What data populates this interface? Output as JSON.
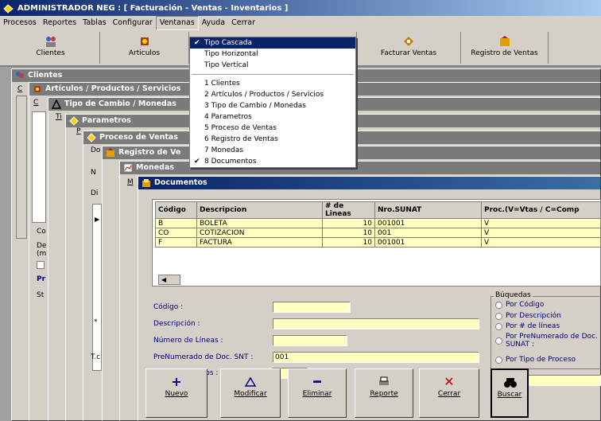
{
  "app": {
    "title": "ADMINISTRADOR NEG : [ Facturación - Ventas - Inventarios ]"
  },
  "menubar": [
    "Procesos",
    "Reportes",
    "Tablas",
    "Configurar",
    "Ventanas",
    "Ayuda",
    "Cerrar"
  ],
  "toolbar": {
    "clientes": "Clientes",
    "articulos": "Articulos",
    "facturar": "Facturar Ventas",
    "registro": "Registro de Ventas"
  },
  "ventanas_menu": {
    "layout_items": [
      "Tipo Cascada",
      "Tipo Horizontal",
      "Tipo Vertical"
    ],
    "window_items": [
      "1 Clientes",
      "2 Artículos / Productos / Servicios",
      "3 Tipo de Cambio / Monedas",
      "4 Parametros",
      "5 Proceso de Ventas",
      "6 Registro de Ventas",
      "7 Monedas",
      "8 Documentos"
    ]
  },
  "windows": {
    "clientes": "Clientes",
    "articulos": "Artículos / Productos / Servicios",
    "tipo_cambio": "Tipo de Cambio / Monedas",
    "parametros": "Parametros",
    "proceso": "Proceso de Ventas",
    "registro": "Registro de Ve",
    "monedas": "Monedas",
    "documentos": "Documentos"
  },
  "bg_labels": {
    "c1": "C",
    "c2": "C",
    "ti": "Ti",
    "p": "P",
    "do": "Do",
    "n": "N",
    "di": "Di",
    "m": "M",
    "co": "Co",
    "de": "De",
    "im": "(m",
    "pr": "Pr",
    "st": "St",
    "tc": "T.c",
    "star": "*"
  },
  "grid": {
    "headers": [
      "Código",
      "Descripcion",
      "# de Lineas",
      "Nro.SUNAT",
      "Proc.(V=Vtas / C=Comp"
    ],
    "rows": [
      [
        "B",
        "BOLETA",
        "10",
        "001001",
        "V"
      ],
      [
        "CO",
        "COTIZACION",
        "10",
        "001",
        "V"
      ],
      [
        "F",
        "FACTURA",
        "10",
        "001001",
        "V"
      ]
    ]
  },
  "form": {
    "codigo": "Código :",
    "descripcion": "Descripción :",
    "lineas": "Número de Líneas :",
    "prenumerado": "PreNumerado de Doc. SNT :",
    "prenumerado_value": "001",
    "tipo_proceso": "Tipo de Procesos :"
  },
  "busquedas": {
    "title": "Búquedas",
    "options": [
      "Por Código",
      "Por Descripción",
      "Por # de líneas",
      "Por PreNumerado de Doc. SUNAT :",
      "Por Tipo de Proceso"
    ]
  },
  "buttons": {
    "nuevo": "Nuevo",
    "modificar": "Modificar",
    "eliminar": "Eliminar",
    "reporte": "Reporte",
    "cerrar": "Cerrar",
    "buscar": "Buscar"
  },
  "colors": {
    "active_title": "#0a246a",
    "field_bg": "#ffffc0",
    "label": "#000080",
    "close_red": "#cc0000"
  }
}
